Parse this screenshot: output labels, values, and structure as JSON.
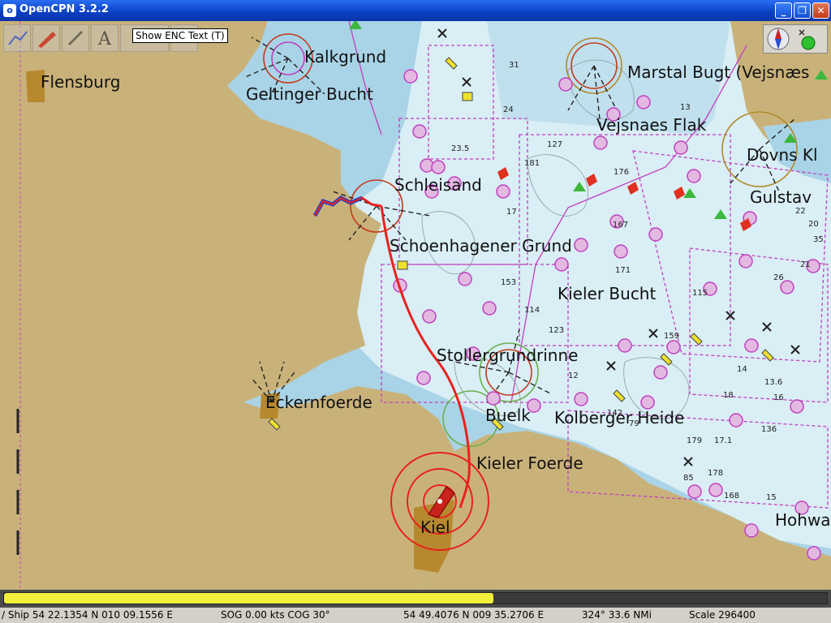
{
  "window": {
    "title": "OpenCPN 3.2.2",
    "app_icon": "o",
    "buttons": {
      "minimize": "_",
      "maximize": "❐",
      "close": "✕"
    }
  },
  "toolbar": {
    "tooltip": "Show ENC Text (T)",
    "icons": [
      "route-icon",
      "ship-icon",
      "measure-icon",
      "text-icon",
      "layers-icon",
      "tide-icon"
    ]
  },
  "compass": {
    "icons": [
      "compass-icon",
      "gps-status-icon"
    ]
  },
  "places": {
    "flensburg": "Flensburg",
    "geltinger_bucht": "Geltinger Bucht",
    "kalkgrund": "Kalkgrund",
    "marstal": "Marstal Bugt (Vejsnæs",
    "vejsnaes": "Vejsnaes Flak",
    "dovns": "Dovns Kl",
    "gulstav": "Gulstav",
    "schleisand": "Schleisand",
    "schoenhagener": "Schoenhagener Grund",
    "kieler_bucht": "Kieler Bucht",
    "stollergrund": "Stollergrundrinne",
    "eckernfoerde": "Eckernfoerde",
    "kolberger": "Kolberger Heide",
    "kieler_foerde": "Kieler Foerde",
    "kiel": "Kiel",
    "hohwacht": "Hohwa",
    "buelk": "Buelk"
  },
  "depths": [
    "31",
    "24",
    "13",
    "23.5",
    "127",
    "181",
    "176",
    "17",
    "167",
    "171",
    "153",
    "114",
    "123",
    "178",
    "22",
    "115",
    "159",
    "21",
    "14",
    "18",
    "12",
    "20",
    "35",
    "85",
    "79",
    "17.1",
    "136",
    "179",
    "168",
    "142",
    "16",
    "13.6",
    "15",
    "26"
  ],
  "progress": {
    "fraction": 0.595,
    "color": "#f2ef3d"
  },
  "status": {
    "ship": "/ Ship 54 22.1354 N   010 09.1556 E",
    "sog_cog": "SOG 0.00 kts  COG 30°",
    "cursor": "54 49.4076 N   009 35.2706 E",
    "bearing": "324°  33.6 NMi",
    "scale": "Scale 296400"
  },
  "colors": {
    "land": "#c9b27a",
    "water_shallow": "#a9d3e6",
    "water_deep": "#d9eef5",
    "track": "#e8221e",
    "magenta": "#c23fbf"
  }
}
